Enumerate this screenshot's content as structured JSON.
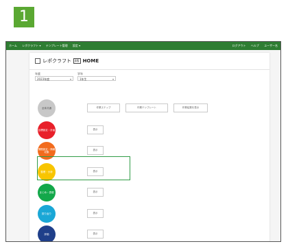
{
  "step_number": "1",
  "topbar": {
    "nav_items": [
      "ホーム",
      "レポクラフト ▾",
      "テンプレート管理",
      "設定 ▾"
    ],
    "right_items": [
      "ログアウト",
      "ヘルプ",
      "ユーザー名"
    ]
  },
  "app": {
    "name": "レポクラフト",
    "tag": "β版",
    "page": "HOME"
  },
  "filters": {
    "year_label": "年度",
    "year_value": "2023年度",
    "class_label": "学年",
    "class_value": "1年生"
  },
  "categories": [
    {
      "label": "全体共通",
      "color": "#c8c8c8",
      "buttons": [
        "作業ステップ",
        "作業テンプレート",
        "作業結果を表示"
      ]
    },
    {
      "label": "目標設定・計画",
      "color": "#e8202a",
      "buttons": [
        "表示"
      ]
    },
    {
      "label": "課題設定・情報収集",
      "color": "#f26b1d",
      "buttons": [
        "表示"
      ]
    },
    {
      "label": "整理・分析",
      "color": "#f8c500",
      "buttons": [
        "表示"
      ]
    },
    {
      "label": "まとめ・表現",
      "color": "#13a84a",
      "buttons": [
        "表示"
      ]
    },
    {
      "label": "振り返り",
      "color": "#1aa7d6",
      "buttons": [
        "表示"
      ]
    },
    {
      "label": "評価",
      "color": "#1f3f8a",
      "buttons": [
        "表示"
      ]
    }
  ],
  "colors": {
    "topbar": "#2e7d32",
    "step_badge": "#5aa832",
    "highlight": "#2f9b45"
  }
}
